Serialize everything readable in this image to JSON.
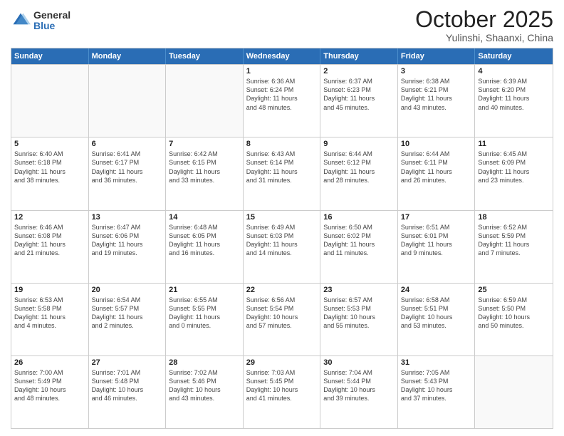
{
  "header": {
    "logo_general": "General",
    "logo_blue": "Blue",
    "title": "October 2025",
    "location": "Yulinshi, Shaanxi, China"
  },
  "days": [
    "Sunday",
    "Monday",
    "Tuesday",
    "Wednesday",
    "Thursday",
    "Friday",
    "Saturday"
  ],
  "weeks": [
    [
      {
        "date": "",
        "info": ""
      },
      {
        "date": "",
        "info": ""
      },
      {
        "date": "",
        "info": ""
      },
      {
        "date": "1",
        "info": "Sunrise: 6:36 AM\nSunset: 6:24 PM\nDaylight: 11 hours\nand 48 minutes."
      },
      {
        "date": "2",
        "info": "Sunrise: 6:37 AM\nSunset: 6:23 PM\nDaylight: 11 hours\nand 45 minutes."
      },
      {
        "date": "3",
        "info": "Sunrise: 6:38 AM\nSunset: 6:21 PM\nDaylight: 11 hours\nand 43 minutes."
      },
      {
        "date": "4",
        "info": "Sunrise: 6:39 AM\nSunset: 6:20 PM\nDaylight: 11 hours\nand 40 minutes."
      }
    ],
    [
      {
        "date": "5",
        "info": "Sunrise: 6:40 AM\nSunset: 6:18 PM\nDaylight: 11 hours\nand 38 minutes."
      },
      {
        "date": "6",
        "info": "Sunrise: 6:41 AM\nSunset: 6:17 PM\nDaylight: 11 hours\nand 36 minutes."
      },
      {
        "date": "7",
        "info": "Sunrise: 6:42 AM\nSunset: 6:15 PM\nDaylight: 11 hours\nand 33 minutes."
      },
      {
        "date": "8",
        "info": "Sunrise: 6:43 AM\nSunset: 6:14 PM\nDaylight: 11 hours\nand 31 minutes."
      },
      {
        "date": "9",
        "info": "Sunrise: 6:44 AM\nSunset: 6:12 PM\nDaylight: 11 hours\nand 28 minutes."
      },
      {
        "date": "10",
        "info": "Sunrise: 6:44 AM\nSunset: 6:11 PM\nDaylight: 11 hours\nand 26 minutes."
      },
      {
        "date": "11",
        "info": "Sunrise: 6:45 AM\nSunset: 6:09 PM\nDaylight: 11 hours\nand 23 minutes."
      }
    ],
    [
      {
        "date": "12",
        "info": "Sunrise: 6:46 AM\nSunset: 6:08 PM\nDaylight: 11 hours\nand 21 minutes."
      },
      {
        "date": "13",
        "info": "Sunrise: 6:47 AM\nSunset: 6:06 PM\nDaylight: 11 hours\nand 19 minutes."
      },
      {
        "date": "14",
        "info": "Sunrise: 6:48 AM\nSunset: 6:05 PM\nDaylight: 11 hours\nand 16 minutes."
      },
      {
        "date": "15",
        "info": "Sunrise: 6:49 AM\nSunset: 6:03 PM\nDaylight: 11 hours\nand 14 minutes."
      },
      {
        "date": "16",
        "info": "Sunrise: 6:50 AM\nSunset: 6:02 PM\nDaylight: 11 hours\nand 11 minutes."
      },
      {
        "date": "17",
        "info": "Sunrise: 6:51 AM\nSunset: 6:01 PM\nDaylight: 11 hours\nand 9 minutes."
      },
      {
        "date": "18",
        "info": "Sunrise: 6:52 AM\nSunset: 5:59 PM\nDaylight: 11 hours\nand 7 minutes."
      }
    ],
    [
      {
        "date": "19",
        "info": "Sunrise: 6:53 AM\nSunset: 5:58 PM\nDaylight: 11 hours\nand 4 minutes."
      },
      {
        "date": "20",
        "info": "Sunrise: 6:54 AM\nSunset: 5:57 PM\nDaylight: 11 hours\nand 2 minutes."
      },
      {
        "date": "21",
        "info": "Sunrise: 6:55 AM\nSunset: 5:55 PM\nDaylight: 11 hours\nand 0 minutes."
      },
      {
        "date": "22",
        "info": "Sunrise: 6:56 AM\nSunset: 5:54 PM\nDaylight: 10 hours\nand 57 minutes."
      },
      {
        "date": "23",
        "info": "Sunrise: 6:57 AM\nSunset: 5:53 PM\nDaylight: 10 hours\nand 55 minutes."
      },
      {
        "date": "24",
        "info": "Sunrise: 6:58 AM\nSunset: 5:51 PM\nDaylight: 10 hours\nand 53 minutes."
      },
      {
        "date": "25",
        "info": "Sunrise: 6:59 AM\nSunset: 5:50 PM\nDaylight: 10 hours\nand 50 minutes."
      }
    ],
    [
      {
        "date": "26",
        "info": "Sunrise: 7:00 AM\nSunset: 5:49 PM\nDaylight: 10 hours\nand 48 minutes."
      },
      {
        "date": "27",
        "info": "Sunrise: 7:01 AM\nSunset: 5:48 PM\nDaylight: 10 hours\nand 46 minutes."
      },
      {
        "date": "28",
        "info": "Sunrise: 7:02 AM\nSunset: 5:46 PM\nDaylight: 10 hours\nand 43 minutes."
      },
      {
        "date": "29",
        "info": "Sunrise: 7:03 AM\nSunset: 5:45 PM\nDaylight: 10 hours\nand 41 minutes."
      },
      {
        "date": "30",
        "info": "Sunrise: 7:04 AM\nSunset: 5:44 PM\nDaylight: 10 hours\nand 39 minutes."
      },
      {
        "date": "31",
        "info": "Sunrise: 7:05 AM\nSunset: 5:43 PM\nDaylight: 10 hours\nand 37 minutes."
      },
      {
        "date": "",
        "info": ""
      }
    ]
  ]
}
